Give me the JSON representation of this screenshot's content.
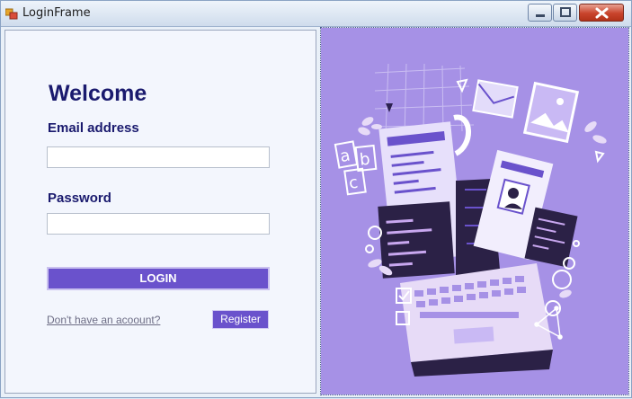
{
  "window": {
    "title": "LoginFrame"
  },
  "controls": {
    "minimize": "minimize",
    "maximize": "maximize",
    "close": "close"
  },
  "form": {
    "heading": "Welcome",
    "email_label": "Email address",
    "email_value": "",
    "password_label": "Password",
    "password_value": "",
    "login_label": "LOGIN",
    "signup_link": "Don't have an acoount?",
    "register_label": "Register"
  },
  "illustration": {
    "background": "#a691e6",
    "letters": [
      "a",
      "b",
      "c"
    ]
  },
  "colors": {
    "accent": "#6a52cc",
    "heading": "#1a1a6e"
  }
}
